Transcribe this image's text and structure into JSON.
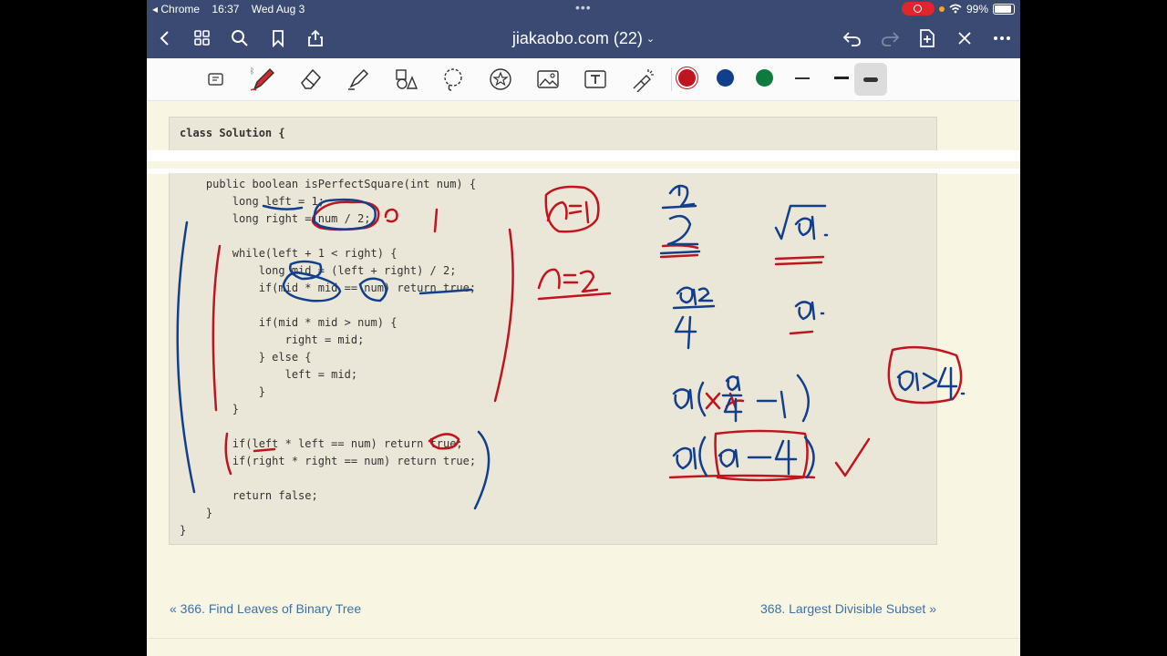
{
  "status": {
    "back_app": "◂ Chrome",
    "time": "16:37",
    "date": "Wed Aug 3",
    "battery": "99%"
  },
  "nav": {
    "title": "jiakaobo.com (22)"
  },
  "colors": {
    "nav_bg": "#3a4a72",
    "red": "#c0141e",
    "blue": "#123f8c",
    "green": "#0f7a3d",
    "link": "#3973a8"
  },
  "icons": [
    "back-icon",
    "tabs-grid-icon",
    "search-icon",
    "bookmark-icon",
    "share-icon",
    "undo-icon",
    "redo-icon",
    "add-page-icon",
    "close-icon",
    "more-icon",
    "pen-icon",
    "eraser-icon",
    "highlighter-icon",
    "shapes-icon",
    "lasso-icon",
    "sticker-icon",
    "image-icon",
    "text-icon",
    "laser-icon"
  ],
  "code": {
    "header": "class Solution {",
    "lines": [
      "    public boolean isPerfectSquare(int num) {",
      "        long left = 1;",
      "        long right = num / 2;",
      "",
      "        while(left + 1 < right) {",
      "            long mid = (left + right) / 2;",
      "            if(mid * mid == num) return true;",
      "",
      "            if(mid * mid > num) {",
      "                right = mid;",
      "            } else {",
      "                left = mid;",
      "            }",
      "        }",
      "",
      "        if(left * left == num) return true;",
      "        if(right * right == num) return true;",
      "",
      "        return false;",
      "    }",
      "}"
    ]
  },
  "links": {
    "prev": "« 366. Find Leaves of Binary Tree",
    "next": "368. Largest Divisible Subset »"
  }
}
